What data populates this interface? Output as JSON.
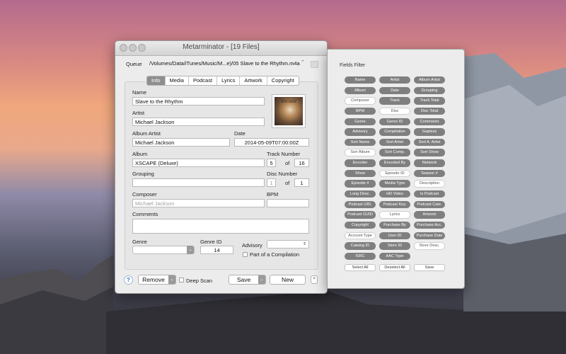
{
  "window": {
    "title": "Metarminator - [19 Files]",
    "queue_label": "Queue",
    "queue_value": "/Volumes/Data/iTunes/Music/M...e)/05 Slave to the Rhythm.m4a"
  },
  "tabs": [
    "Info",
    "Media",
    "Podcast",
    "Lyrics",
    "Artwork",
    "Copyright"
  ],
  "active_tab": "Info",
  "info": {
    "name_label": "Name",
    "name": "Slave to the Rhythm",
    "artist_label": "Artist",
    "artist": "Michael Jackson",
    "album_artist_label": "Album Artist",
    "album_artist": "Michael Jackson",
    "date_label": "Date",
    "date": "2014-05-09T07:00:00Z",
    "album_label": "Album",
    "album": "XSCAPE (Deluxe)",
    "track_number_label": "Track Number",
    "track_number": "5",
    "track_of": "of",
    "track_total": "16",
    "grouping_label": "Grouping",
    "grouping": "",
    "disc_number_label": "Disc Number",
    "disc_number": "1",
    "disc_of": "of",
    "disc_total": "1",
    "composer_label": "Composer",
    "composer_placeholder": "Michael Jackson",
    "bpm_label": "BPM",
    "bpm": "",
    "comments_label": "Comments",
    "comments": "",
    "genre_label": "Genre",
    "genre": "",
    "genre_id_label": "Genre ID",
    "genre_id": "14",
    "advisory_label": "Advisory",
    "advisory": "",
    "compilation_label": "Part of a Compilation",
    "artwork_text": "XSCAPE"
  },
  "bottom": {
    "help": "?",
    "remove": "Remove",
    "deep_scan": "Deep Scan",
    "save": "Save",
    "new": "New"
  },
  "panel": {
    "title": "Fields Filter",
    "fields": [
      {
        "label": "Name",
        "on": true
      },
      {
        "label": "Artist",
        "on": true
      },
      {
        "label": "Album Artist",
        "on": true
      },
      {
        "label": "Album",
        "on": true
      },
      {
        "label": "Date",
        "on": true
      },
      {
        "label": "Grouping",
        "on": true
      },
      {
        "label": "Composer",
        "on": false
      },
      {
        "label": "Track",
        "on": true
      },
      {
        "label": "Track Total",
        "on": true
      },
      {
        "label": "BPM",
        "on": true
      },
      {
        "label": "Disc",
        "on": false
      },
      {
        "label": "Disc Total",
        "on": true
      },
      {
        "label": "Genre",
        "on": true
      },
      {
        "label": "Genre ID",
        "on": true
      },
      {
        "label": "Comments",
        "on": true
      },
      {
        "label": "Advisory",
        "on": true
      },
      {
        "label": "Compilation",
        "on": true
      },
      {
        "label": "Gapless",
        "on": true
      },
      {
        "label": "Sort Name",
        "on": true
      },
      {
        "label": "Sort Artist",
        "on": true
      },
      {
        "label": "Sort A. Artist",
        "on": true
      },
      {
        "label": "Sort Album",
        "on": false
      },
      {
        "label": "Sort Comp.",
        "on": true
      },
      {
        "label": "Sort Show",
        "on": true
      },
      {
        "label": "Encoder",
        "on": true
      },
      {
        "label": "Encoded By",
        "on": true
      },
      {
        "label": "Network",
        "on": true
      },
      {
        "label": "Show",
        "on": true
      },
      {
        "label": "Episode ID",
        "on": false
      },
      {
        "label": "Season #",
        "on": true
      },
      {
        "label": "Episode #",
        "on": true
      },
      {
        "label": "Media Type",
        "on": true
      },
      {
        "label": "Description",
        "on": false
      },
      {
        "label": "Long Desc.",
        "on": true
      },
      {
        "label": "HD Video",
        "on": true
      },
      {
        "label": "Is Podcast",
        "on": true
      },
      {
        "label": "Podcast URL",
        "on": true
      },
      {
        "label": "Podcast Key.",
        "on": true
      },
      {
        "label": "Podcast Cate.",
        "on": true
      },
      {
        "label": "Podcast GUID",
        "on": true
      },
      {
        "label": "Lyrics",
        "on": false
      },
      {
        "label": "Artwork",
        "on": true
      },
      {
        "label": "Copyright",
        "on": true
      },
      {
        "label": "Purchase By",
        "on": true
      },
      {
        "label": "Purchase Acc.",
        "on": true
      },
      {
        "label": "Account Type",
        "on": false
      },
      {
        "label": "User ID",
        "on": true
      },
      {
        "label": "Purchase Date",
        "on": true
      },
      {
        "label": "Catalog ID",
        "on": true
      },
      {
        "label": "Store ID",
        "on": true
      },
      {
        "label": "Store Desc.",
        "on": false
      },
      {
        "label": "ISRC",
        "on": true
      },
      {
        "label": "AAC Type",
        "on": true
      }
    ],
    "select_all": "Select All",
    "deselect_all": "Deselect All",
    "save": "Save"
  }
}
